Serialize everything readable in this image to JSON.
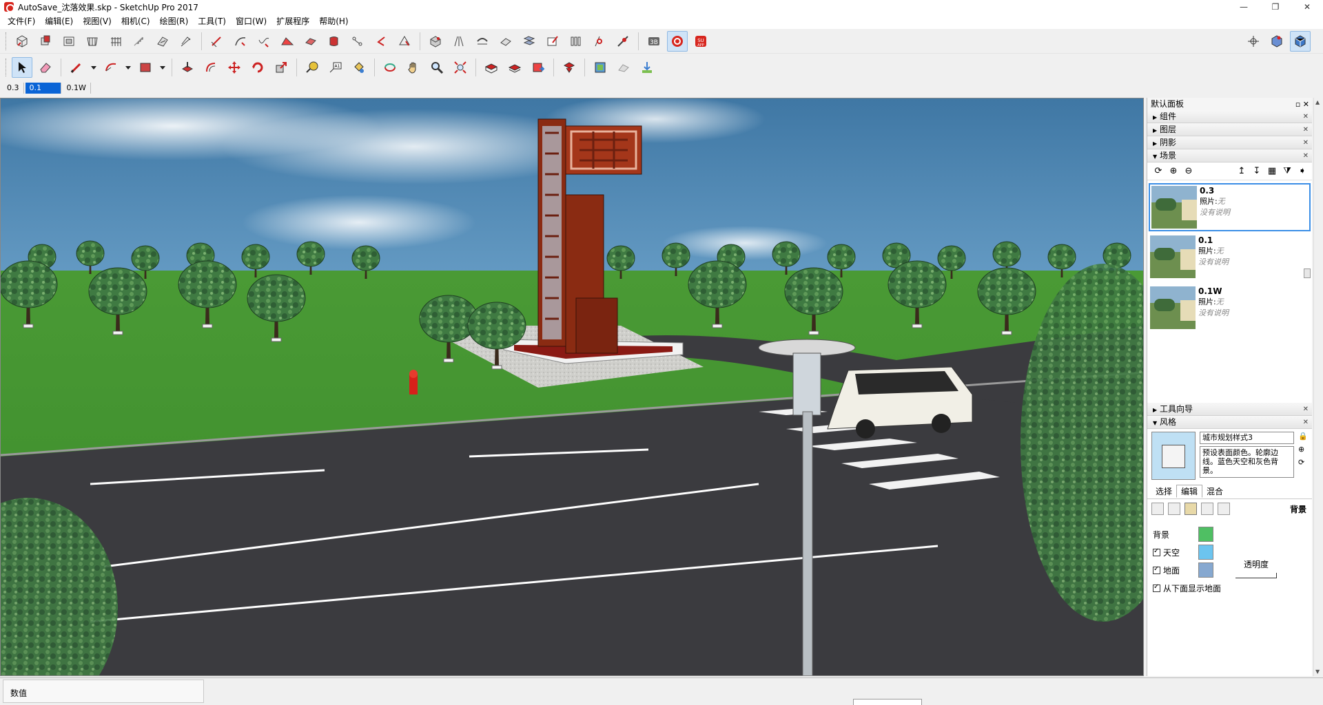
{
  "window": {
    "title": "AutoSave_沈落效果.skp - SketchUp Pro 2017",
    "controls": [
      "—",
      "❐",
      "✕"
    ]
  },
  "menu": [
    "文件(F)",
    "编辑(E)",
    "视图(V)",
    "相机(C)",
    "绘图(R)",
    "工具(T)",
    "窗口(W)",
    "扩展程序",
    "帮助(H)"
  ],
  "scene_tabs": [
    {
      "label": "0.3",
      "selected": false
    },
    {
      "label": "0.1",
      "selected": true
    },
    {
      "label": "0.1W",
      "selected": false
    }
  ],
  "tray": {
    "title": "默认面板",
    "pin": "▫ ✕",
    "panels": {
      "components": "组件",
      "layers": "图层",
      "shadows": "阴影",
      "scenes": "场景",
      "instructor": "工具向导",
      "styles": "风格"
    },
    "scenes": [
      {
        "name": "0.3",
        "photo_label": "照片:",
        "photo_value": "无",
        "desc": "没有说明",
        "selected": true
      },
      {
        "name": "0.1",
        "photo_label": "照片:",
        "photo_value": "无",
        "desc": "没有说明",
        "selected": false
      },
      {
        "name": "0.1W",
        "photo_label": "照片:",
        "photo_value": "无",
        "desc": "没有说明",
        "selected": false
      }
    ],
    "style": {
      "name": "城市规划样式3",
      "description": "预设表面颜色。轮廓边线。蓝色天空和灰色背景。",
      "tabs": [
        "选择",
        "编辑",
        "混合"
      ],
      "active_tab": "编辑",
      "section_label": "背景",
      "rows": [
        {
          "label": "背景",
          "checkbox": false,
          "color": "#4fbf63"
        },
        {
          "label": "天空",
          "checkbox": true,
          "color": "#6cc4ef"
        },
        {
          "label": "地面",
          "checkbox": true,
          "color": "#86a8d0"
        },
        {
          "label": "从下面显示地面",
          "checkbox": true,
          "color": null
        }
      ],
      "transparency_label": "透明度"
    }
  },
  "status": {
    "measure_label": "数值"
  },
  "toolbar_right_icons": [
    "standard-view-icon",
    "component-icon",
    "styles-icon"
  ],
  "colors": {
    "sky": "#4a80ad",
    "grass": "#3b8d2e",
    "road": "#3a3a3e",
    "tower": "#8a2b12",
    "selection": "#0a64d6"
  }
}
